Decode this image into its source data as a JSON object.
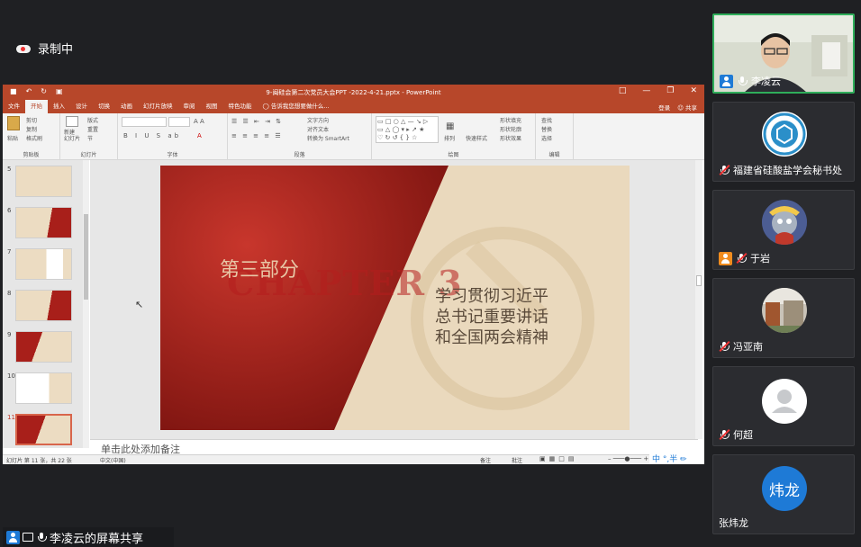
{
  "meeting": {
    "recording_label": "录制中",
    "share_label": "李凌云的屏幕共享"
  },
  "ppt": {
    "title": "9-闽硅会第二次党员大会PPT -2022-4-21.pptx - PowerPoint",
    "tabs": [
      "文件",
      "开始",
      "插入",
      "设计",
      "切换",
      "动画",
      "幻灯片放映",
      "审阅",
      "视图",
      "特色功能"
    ],
    "search_hint": "告诉我您想要做什么...",
    "login": "登录",
    "share": "共享",
    "ribbon": {
      "paste": "粘贴",
      "cut": "剪切",
      "copy": "复制",
      "format_painter": "格式刷",
      "new_slide": "新建\n幻灯片",
      "layout": "版式",
      "reset": "重置",
      "section": "节",
      "text_direction": "文字方向",
      "align_text": "对齐文本",
      "smartart": "转换为 SmartArt",
      "arrange": "排列",
      "quick_styles": "快速样式",
      "shape_fill": "形状填充",
      "shape_outline": "形状轮廓",
      "shape_effects": "形状效果",
      "find": "查找",
      "replace": "替换",
      "select": "选择",
      "groups": [
        "剪贴板",
        "幻灯片",
        "字体",
        "段落",
        "绘图",
        "编辑"
      ]
    },
    "thumb_numbers": [
      "5",
      "6",
      "7",
      "8",
      "9",
      "10",
      "11"
    ],
    "slide": {
      "part": "第三部分",
      "chapter": "CHAPTER 3",
      "heading": [
        "学习贯彻习近平",
        "总书记重要讲话",
        "和全国两会精神"
      ]
    },
    "notes_placeholder": "单击此处添加备注",
    "status": {
      "slide_count": "幻灯片 第 11 张，共 22 张",
      "language": "中文(中国)",
      "notes": "备注",
      "comments": "批注"
    }
  },
  "participants": [
    {
      "name": "李凌云",
      "type": "video"
    },
    {
      "name": "福建省硅酸盐学会秘书处",
      "type": "logo"
    },
    {
      "name": "于岩",
      "type": "avatar"
    },
    {
      "name": "冯亚南",
      "type": "photo"
    },
    {
      "name": "何超",
      "type": "default"
    },
    {
      "name": "张炜龙",
      "type": "initials",
      "initials": "炜龙"
    }
  ],
  "colors": {
    "ppt_red": "#b7472a",
    "slide_red": "#a81f1a",
    "slide_beige": "#ead9bd",
    "avatar_blue": "#1e7ad6"
  }
}
